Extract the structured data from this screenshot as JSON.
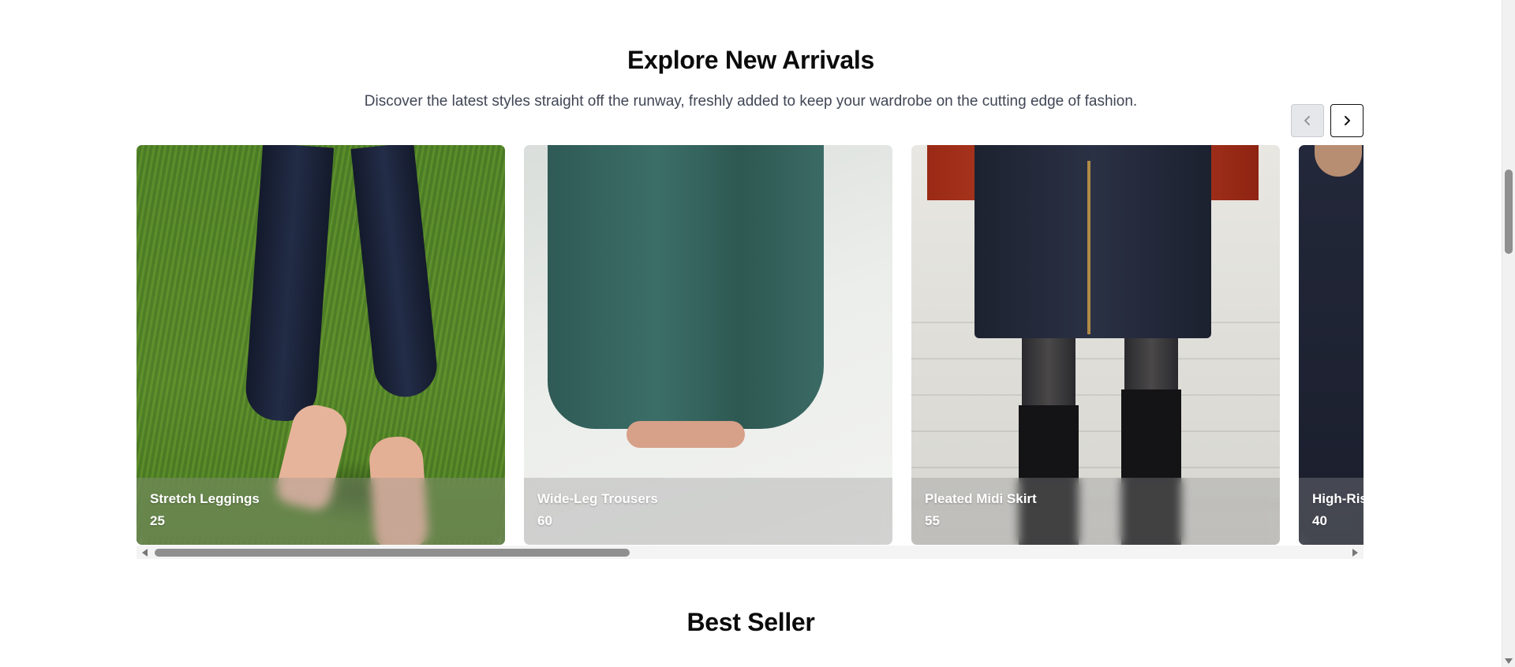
{
  "new_arrivals": {
    "title": "Explore New Arrivals",
    "subtitle": "Discover the latest styles straight off the runway, freshly added to keep your wardrobe on the cutting edge of fashion.",
    "prev_icon": "chevron-left-icon",
    "next_icon": "chevron-right-icon",
    "cards": [
      {
        "name": "Stretch Leggings",
        "count": "25"
      },
      {
        "name": "Wide-Leg Trousers",
        "count": "60"
      },
      {
        "name": "Pleated Midi Skirt",
        "count": "55"
      },
      {
        "name": "High-Ris",
        "count": "40"
      }
    ]
  },
  "best_seller": {
    "title": "Best Seller"
  }
}
